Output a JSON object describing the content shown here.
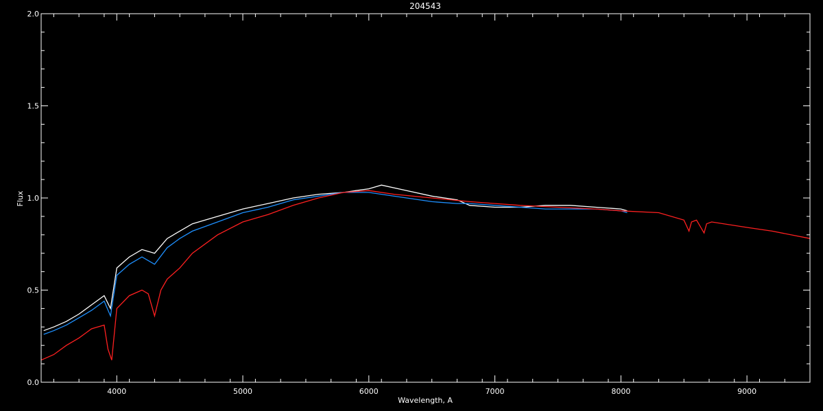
{
  "chart_data": {
    "type": "line",
    "title": "204543",
    "xlabel": "Wavelength, A",
    "ylabel": "Flux",
    "xlim": [
      3400,
      9500
    ],
    "ylim": [
      0.0,
      2.0
    ],
    "x_ticks": [
      4000,
      5000,
      6000,
      7000,
      8000,
      9000
    ],
    "x_tick_labels": [
      "4000",
      "5000",
      "6000",
      "7000",
      "8000",
      "9000"
    ],
    "y_ticks": [
      0.0,
      0.5,
      1.0,
      1.5,
      2.0
    ],
    "y_tick_labels": [
      "0.0",
      "0.5",
      "1.0",
      "1.5",
      "2.0"
    ],
    "grid": false,
    "background": "#000000",
    "axis_color": "#ffffff",
    "series": [
      {
        "color": "#ffffff",
        "x": [
          3420,
          3500,
          3600,
          3700,
          3800,
          3900,
          3950,
          4000,
          4100,
          4200,
          4300,
          4400,
          4500,
          4600,
          4800,
          5000,
          5200,
          5400,
          5600,
          5800,
          5900,
          6000,
          6100,
          6300,
          6500,
          6700,
          6800,
          7000,
          7200,
          7400,
          7600,
          7800,
          8000,
          8050
        ],
        "y": [
          0.28,
          0.3,
          0.33,
          0.37,
          0.42,
          0.47,
          0.4,
          0.62,
          0.68,
          0.72,
          0.7,
          0.78,
          0.82,
          0.86,
          0.9,
          0.94,
          0.97,
          1.0,
          1.02,
          1.03,
          1.04,
          1.05,
          1.07,
          1.04,
          1.01,
          0.99,
          0.96,
          0.95,
          0.95,
          0.96,
          0.96,
          0.95,
          0.94,
          0.93
        ]
      },
      {
        "color": "#1e90ff",
        "x": [
          3420,
          3500,
          3600,
          3700,
          3800,
          3900,
          3950,
          4000,
          4100,
          4200,
          4300,
          4400,
          4500,
          4600,
          4800,
          5000,
          5200,
          5400,
          5600,
          5800,
          5900,
          6000,
          6100,
          6300,
          6500,
          6700,
          6800,
          7000,
          7200,
          7400,
          7600,
          7800,
          8000,
          8050
        ],
        "y": [
          0.26,
          0.28,
          0.31,
          0.35,
          0.39,
          0.44,
          0.36,
          0.58,
          0.64,
          0.68,
          0.64,
          0.73,
          0.78,
          0.82,
          0.87,
          0.92,
          0.95,
          0.99,
          1.01,
          1.03,
          1.03,
          1.03,
          1.02,
          1.0,
          0.98,
          0.97,
          0.97,
          0.96,
          0.95,
          0.94,
          0.94,
          0.94,
          0.93,
          0.92
        ]
      },
      {
        "color": "#ff2020",
        "x": [
          3400,
          3500,
          3600,
          3700,
          3800,
          3850,
          3900,
          3930,
          3960,
          4000,
          4100,
          4200,
          4250,
          4300,
          4350,
          4400,
          4500,
          4600,
          4800,
          5000,
          5200,
          5400,
          5600,
          5800,
          6000,
          6200,
          6500,
          6800,
          7000,
          7200,
          7500,
          7800,
          8000,
          8300,
          8500,
          8540,
          8560,
          8600,
          8660,
          8680,
          8720,
          9000,
          9200,
          9500
        ],
        "y": [
          0.12,
          0.15,
          0.2,
          0.24,
          0.29,
          0.3,
          0.31,
          0.18,
          0.12,
          0.4,
          0.47,
          0.5,
          0.48,
          0.36,
          0.5,
          0.56,
          0.62,
          0.7,
          0.8,
          0.87,
          0.91,
          0.96,
          1.0,
          1.03,
          1.04,
          1.02,
          1.0,
          0.98,
          0.97,
          0.96,
          0.95,
          0.94,
          0.93,
          0.92,
          0.88,
          0.82,
          0.87,
          0.88,
          0.81,
          0.86,
          0.87,
          0.84,
          0.82,
          0.78
        ]
      }
    ]
  }
}
